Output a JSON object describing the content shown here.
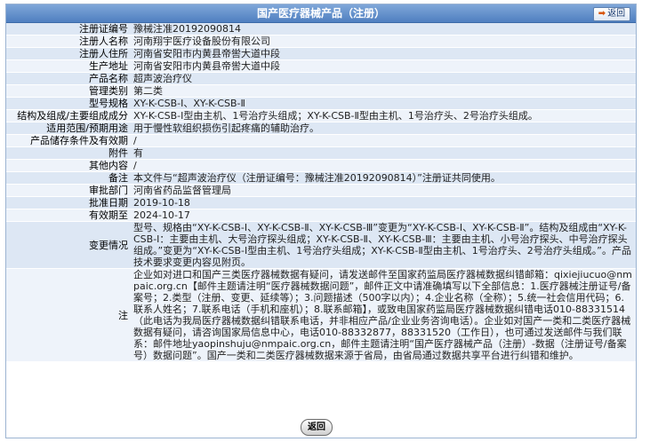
{
  "window": {
    "title": "国产医疗器械产品（注册）",
    "back_top_label": "返回",
    "back_bottom_label": "返回"
  },
  "fields": [
    {
      "label": "注册证编号",
      "value": "豫械注准20192090814"
    },
    {
      "label": "注册人名称",
      "value": "河南翔宇医疗设备股份有限公司"
    },
    {
      "label": "注册人住所",
      "value": "河南省安阳市内黄县帝喾大道中段"
    },
    {
      "label": "生产地址",
      "value": "河南省安阳市内黄县帝喾大道中段"
    },
    {
      "label": "产品名称",
      "value": "超声波治疗仪"
    },
    {
      "label": "管理类别",
      "value": "第二类"
    },
    {
      "label": "型号规格",
      "value": "XY-K-CSB-Ⅰ、XY-K-CSB-Ⅱ"
    },
    {
      "label": "结构及组成/主要组成成分",
      "value": "XY-K-CSB-Ⅰ型由主机、1号治疗头组成；XY-K-CSB-Ⅱ型由主机、1号治疗头、2号治疗头组成。"
    },
    {
      "label": "适用范围/预期用途",
      "value": "用于慢性软组织损伤引起疼痛的辅助治疗。"
    },
    {
      "label": "产品储存条件及有效期",
      "value": "/"
    },
    {
      "label": "附件",
      "value": "有"
    },
    {
      "label": "其他内容",
      "value": "/"
    },
    {
      "label": "备注",
      "value": "本文件与“超声波治疗仪（注册证编号：豫械注准20192090814）”注册证共同使用。"
    },
    {
      "label": "审批部门",
      "value": "河南省药品监督管理局"
    },
    {
      "label": "批准日期",
      "value": "2019-10-18"
    },
    {
      "label": "有效期至",
      "value": "2024-10-17"
    },
    {
      "label": "变更情况",
      "value": "型号、规格由“XY-K-CSB-Ⅰ、XY-K-CSB-Ⅱ、XY-K-CSB-Ⅲ”变更为“XY-K-CSB-Ⅰ、XY-K-CSB-Ⅱ”。结构及组成由“XY-K-CSB-Ⅰ：主要由主机、大号治疗探头组成；XY-K-CSB-Ⅱ、XY-K-CSB-Ⅲ：主要由主机、小号治疗探头、中号治疗探头组成。”变更为“XY-K-CSB-Ⅰ型由主机、1号治疗头组成；XY-K-CSB-Ⅱ型由主机、1号治疗头、2号治疗头组成。”。产品技术要求变更内容见附页。"
    },
    {
      "label": "注",
      "value": "企业如对进口和国产三类医疗器械数据有疑问，请发送邮件至国家药监局医疗器械数据纠错邮箱：qixiejiucuo@nmpaic.org.cn【邮件主题请注明“医疗器械数据问题”，邮件正文中请准确填写以下全部信息：1.医疗器械注册证号/备案号；2.类型（注册、变更、延续等）；3.问题描述（500字以内）；4.企业名称（全称）；5.统一社会信用代码；6.联系人姓名；7.联系电话（手机和座机）；8.联系邮箱】，或致电国家药监局医疗器械数据纠错电话010-88331514（此电话为我局医疗器械数据纠错联系电话，并非相应产品/企业业务咨询电话）。企业如对国产一类和二类医疗器械数据有疑问，请咨询国家局信息中心，电话010-88332877，88331520（工作日），也可通过发送邮件与我们联系：邮件地址yaopinshuju@nmpaic.org.cn，邮件主题请注明“国产医疗器械产品（注册）-数据（注册证号/备案号）数据问题”。国产一类和二类医疗器械数据来源于省局，由省局通过数据共享平台进行纠错和维护。"
    }
  ]
}
